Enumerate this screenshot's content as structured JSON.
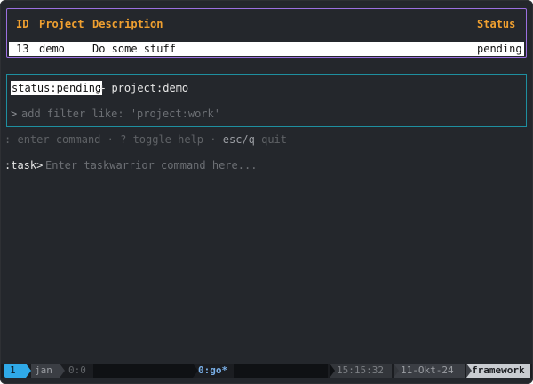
{
  "tasks": {
    "columns": {
      "id": "ID",
      "project": "Project",
      "description": "Description",
      "status": "Status"
    },
    "rows": [
      {
        "id": "13",
        "project": "demo",
        "description": "Do some stuff",
        "status": "pending",
        "selected": true
      }
    ]
  },
  "filter": {
    "active_token": "status:pending",
    "rest": "+ project:demo",
    "prompt": ">",
    "input_value": "",
    "placeholder": "add filter like: 'project:work'"
  },
  "help": {
    "enter_key": ":",
    "enter_text": "enter command",
    "sep": "·",
    "help_key": "?",
    "help_text": "toggle help",
    "quit_key": "esc/q",
    "quit_text": "quit"
  },
  "command": {
    "label": ":task>",
    "input_value": "",
    "placeholder": "Enter taskwarrior command here..."
  },
  "statusbar": {
    "window_index": "1",
    "session": "jan",
    "pane": "0:0",
    "current_window": "0:go*",
    "time": "15:15:32",
    "date": "11-Okt-24",
    "host": "framework"
  },
  "colors": {
    "background": "#24272c",
    "header": "#f0a030",
    "table_border": "#9b6fe0",
    "filter_border": "#1e8fa0",
    "accent_blue": "#2fa9e8"
  }
}
